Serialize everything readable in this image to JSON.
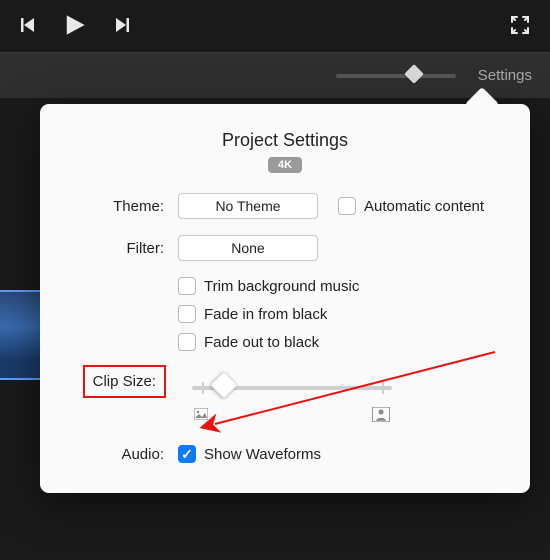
{
  "toolbar": {
    "settings_label": "Settings"
  },
  "popover": {
    "title": "Project Settings",
    "badge": "4K",
    "theme_label": "Theme:",
    "theme_value": "No Theme",
    "auto_content_label": "Automatic content",
    "filter_label": "Filter:",
    "filter_value": "None",
    "trim_label": "Trim background music",
    "fadein_label": "Fade in from black",
    "fadeout_label": "Fade out to black",
    "clipsize_label": "Clip Size:",
    "audio_label": "Audio:",
    "waveforms_label": "Show Waveforms"
  }
}
